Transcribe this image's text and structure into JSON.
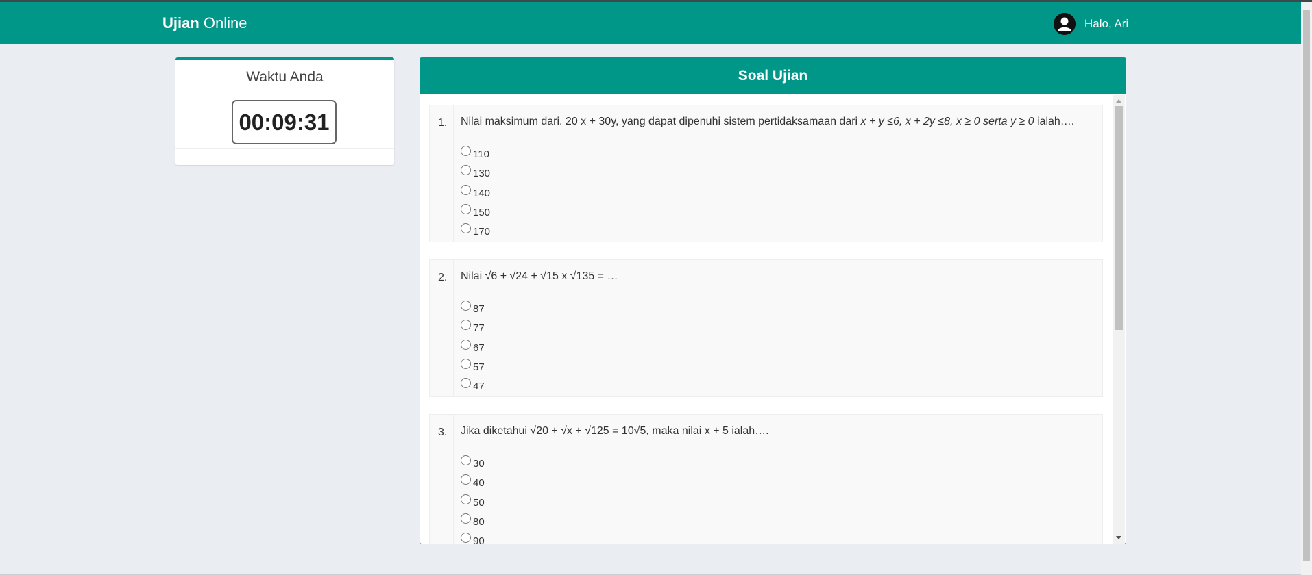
{
  "navbar": {
    "brand_bold": "Ujian",
    "brand_rest": " Online",
    "greeting": "Halo, Ari"
  },
  "timer": {
    "title": "Waktu Anda",
    "value": "00:09:31"
  },
  "exam": {
    "title": "Soal Ujian",
    "questions": [
      {
        "number": "1.",
        "text_before": "Nilai maksimum dari. 20 x + 30y, yang dapat dipenuhi sistem pertidaksamaan dari ",
        "text_italic": "x + y ≤6, x + 2y ≤8, x ≥ 0 serta y ≥ 0",
        "text_after": " ialah….",
        "options": [
          "110",
          "130",
          "140",
          "150",
          "170"
        ]
      },
      {
        "number": "2.",
        "text_before": "Nilai √6 + √24 + √15 x √135 = …",
        "text_italic": "",
        "text_after": "",
        "options": [
          "87",
          "77",
          "67",
          "57",
          "47"
        ]
      },
      {
        "number": "3.",
        "text_before": "Jika diketahui √20 + √x + √125 = 10√5, maka nilai x + 5 ialah….",
        "text_italic": "",
        "text_after": "",
        "options": [
          "30",
          "40",
          "50",
          "80",
          "90"
        ]
      }
    ]
  },
  "colors": {
    "primary": "#009688",
    "background": "#eaeef2"
  },
  "icons": {
    "avatar": "user-avatar-icon"
  }
}
